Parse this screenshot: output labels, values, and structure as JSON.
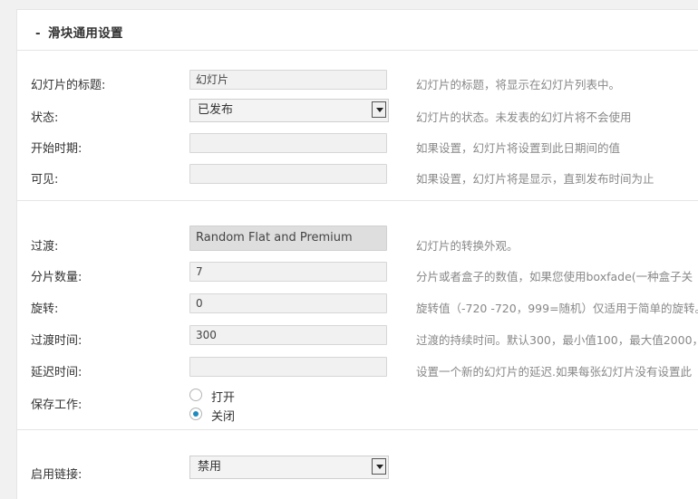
{
  "section": {
    "collapse_glyph": "-",
    "title": "滑块通用设置"
  },
  "fields": {
    "title": {
      "label": "幻灯片的标题:",
      "value": "幻灯片",
      "desc": "幻灯片的标题，将显示在幻灯片列表中。"
    },
    "status": {
      "label": "状态:",
      "value": "已发布",
      "desc": "幻灯片的状态。未发表的幻灯片将不会使用"
    },
    "start_date": {
      "label": "开始时期:",
      "value": "",
      "desc": "如果设置，幻灯片将设置到此日期间的值"
    },
    "visible": {
      "label": "可见:",
      "value": "",
      "desc": "如果设置，幻灯片将是显示，直到发布时间为止"
    },
    "transition": {
      "label": "过渡:",
      "value": "Random Flat and Premium",
      "desc": "幻灯片的转换外观。"
    },
    "slots": {
      "label": "分片数量:",
      "value": "7",
      "desc": "分片或者盒子的数值，如果您使用boxfade(一种盒子关"
    },
    "rotation": {
      "label": "旋转:",
      "value": "0",
      "desc": "旋转值（-720 -720，999=随机）仅适用于简单的旋转。"
    },
    "duration": {
      "label": "过渡时间:",
      "value": "300",
      "desc": "过渡的持续时间。默认300，最小值100，最大值2000，"
    },
    "delay": {
      "label": "延迟时间:",
      "value": "",
      "desc": "设置一个新的幻灯片的延迟.如果每张幻灯片没有设置此"
    },
    "save_work": {
      "label": "保存工作:",
      "options": [
        "打开",
        "关闭"
      ],
      "selected": "关闭"
    },
    "enable_link": {
      "label": "启用链接:",
      "value": "禁用"
    }
  }
}
